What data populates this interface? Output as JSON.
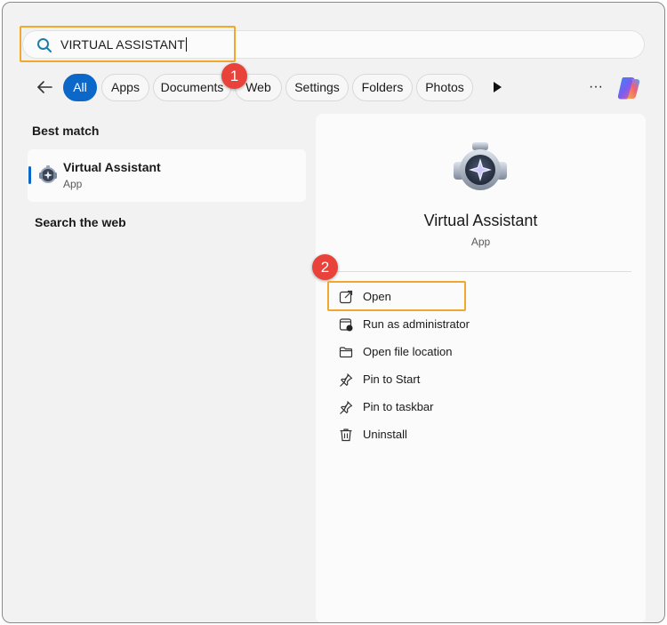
{
  "search": {
    "value": "VIRTUAL ASSISTANT",
    "icon": "search-icon"
  },
  "filters": {
    "back_icon": "arrow-left-icon",
    "chips": [
      "All",
      "Apps",
      "Documents",
      "Web",
      "Settings",
      "Folders",
      "Photos"
    ],
    "active": "All",
    "more_label": "···",
    "accent": "#0b67c8"
  },
  "markers": {
    "step1": "1",
    "step2": "2",
    "color": "#e8423a",
    "highlight_color": "#f0a92c"
  },
  "results": {
    "best_match_title": "Best match",
    "best_match": {
      "name": "Virtual Assistant",
      "type": "App"
    },
    "search_web_title": "Search the web"
  },
  "details": {
    "app_name": "Virtual Assistant",
    "app_type": "App",
    "actions": [
      {
        "label": "Open",
        "icon": "open-external-icon"
      },
      {
        "label": "Run as administrator",
        "icon": "shield-window-icon"
      },
      {
        "label": "Open file location",
        "icon": "folder-icon"
      },
      {
        "label": "Pin to Start",
        "icon": "pin-icon"
      },
      {
        "label": "Pin to taskbar",
        "icon": "pin-icon"
      },
      {
        "label": "Uninstall",
        "icon": "trash-icon"
      }
    ]
  }
}
